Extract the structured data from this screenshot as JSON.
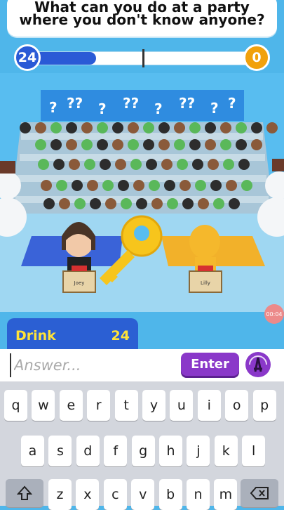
{
  "question": {
    "line1": "What can you do at a party",
    "line2": "where you don't know anyone?"
  },
  "scores": {
    "left": "24",
    "right": "0",
    "progress": 0.3
  },
  "word": {
    "label": "Drink",
    "points": "24"
  },
  "timer": {
    "label": "00:04"
  },
  "players": {
    "left": "Joey",
    "right": "Lilly"
  },
  "answer": {
    "placeholder": "Answer...",
    "enter_label": "Enter"
  },
  "keyboard": {
    "row1": [
      "q",
      "w",
      "e",
      "r",
      "t",
      "y",
      "u",
      "i",
      "o",
      "p"
    ],
    "row2": [
      "a",
      "s",
      "d",
      "f",
      "g",
      "h",
      "j",
      "k",
      "l"
    ],
    "row3": [
      "z",
      "x",
      "c",
      "v",
      "b",
      "n",
      "m"
    ]
  },
  "colors": {
    "team_blue": "#2a5ad6",
    "team_orange": "#f1a10c",
    "enter_purple": "#8a38c9",
    "word_yellow": "#ffe338"
  }
}
